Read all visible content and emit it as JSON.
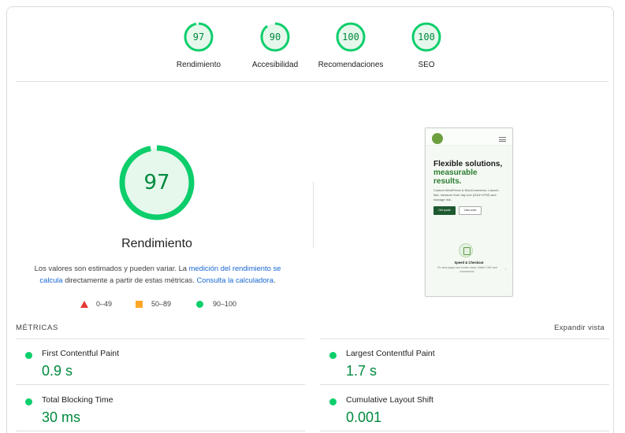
{
  "categories": [
    {
      "score": "97",
      "label": "Rendimiento",
      "fraction": 0.97
    },
    {
      "score": "90",
      "label": "Accesibilidad",
      "fraction": 0.9
    },
    {
      "score": "100",
      "label": "Recomendaciones",
      "fraction": 1.0
    },
    {
      "score": "100",
      "label": "SEO",
      "fraction": 1.0
    }
  ],
  "performance": {
    "score": "97",
    "fraction": 0.97,
    "title": "Rendimiento",
    "desc_1": "Los valores son estimados y pueden variar. La ",
    "desc_link_1": "medición del rendimiento se calcula",
    "desc_2": " directamente a partir de estas métricas. ",
    "desc_link_2": "Consulta la calculadora",
    "desc_3": "."
  },
  "legend": {
    "fail": "0–49",
    "average": "50–89",
    "pass": "90–100"
  },
  "thumbnail": {
    "heading_1": "Flexible solutions,",
    "heading_2": "measurable",
    "heading_3": "results.",
    "subtext": "Custom WordPress & WooCommerce, Launch fast, measure from day one (GA4+GTM) and manage risk.",
    "primary_button": "Get quote",
    "secondary_button": "View work",
    "feature_title": "Speed & Checkout",
    "feature_text": "Fix slow pages and broken steps. Better CWV and conversions.",
    "feature_arrow": "›"
  },
  "metrics": {
    "heading": "MÉTRICAS",
    "expand": "Expandir vista",
    "items": [
      {
        "name": "First Contentful Paint",
        "value": "0.9 s"
      },
      {
        "name": "Largest Contentful Paint",
        "value": "1.7 s"
      },
      {
        "name": "Total Blocking Time",
        "value": "30 ms"
      },
      {
        "name": "Cumulative Layout Shift",
        "value": "0.001"
      }
    ]
  },
  "colors": {
    "pass": "#0cce6b",
    "pass_text": "#008a3e",
    "pass_bg": "#e6f7ec",
    "average": "#ffa726",
    "fail": "#e53935",
    "link": "#1967d2"
  }
}
